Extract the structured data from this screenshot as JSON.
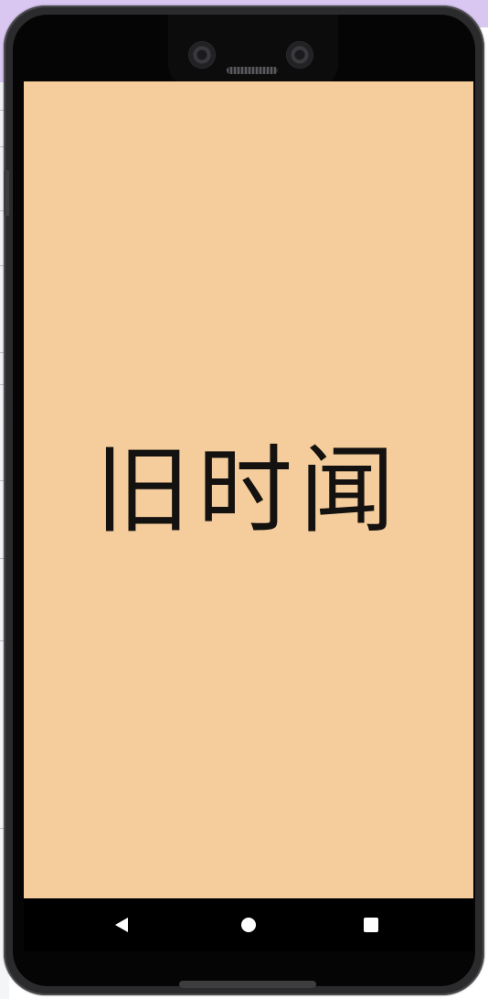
{
  "app": {
    "title": "旧时闻",
    "background_color": "#f5cd9c"
  },
  "navigation_bar": {
    "back": "back-icon",
    "home": "home-icon",
    "recents": "recents-icon"
  },
  "colors": {
    "accent": "#f5cd9c",
    "text": "#141210",
    "bezel": "#2b2b2d"
  }
}
